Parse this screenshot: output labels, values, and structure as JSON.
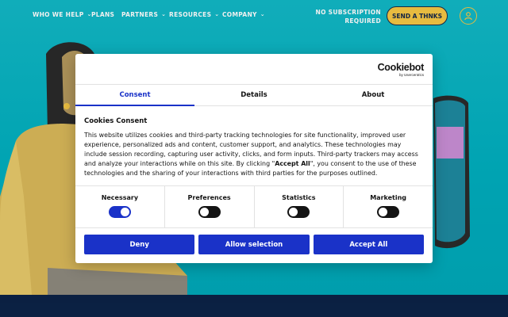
{
  "nav": {
    "items": [
      {
        "label": "WHO WE HELP",
        "has_dropdown": true
      },
      {
        "label": "PLANS",
        "has_dropdown": false
      },
      {
        "label": "PARTNERS",
        "has_dropdown": true
      },
      {
        "label": "RESOURCES",
        "has_dropdown": true
      },
      {
        "label": "COMPANY",
        "has_dropdown": true
      }
    ],
    "no_subscription_line1": "NO SUBSCRIPTION",
    "no_subscription_line2": "REQUIRED",
    "cta_label": "SEND A THNKS",
    "user_icon": "user-icon"
  },
  "cookie_dialog": {
    "brand": "Cookiebot",
    "brand_sub": "by Usercentrics",
    "tabs": [
      "Consent",
      "Details",
      "About"
    ],
    "active_tab": "Consent",
    "heading": "Cookies Consent",
    "body_part1": "This website utilizes cookies and third-party tracking technologies for site functionality, improved user experience, personalized ads and content, customer support, and analytics. These technologies may include session recording, capturing user activity, clicks, and form inputs. Third-party trackers may access and analyze your interactions while on this site. By clicking \"",
    "body_bold": "Accept All",
    "body_part2": "\", you consent to the use of these technologies and the sharing of your interactions with third parties for the purposes outlined.",
    "toggles": [
      {
        "label": "Necessary",
        "on": true
      },
      {
        "label": "Preferences",
        "on": false
      },
      {
        "label": "Statistics",
        "on": false
      },
      {
        "label": "Marketing",
        "on": false
      }
    ],
    "buttons": {
      "deny": "Deny",
      "allow_selection": "Allow selection",
      "accept_all": "Accept All"
    }
  },
  "colors": {
    "hero_bg": "#00b2c2",
    "accent_yellow": "#f6c744",
    "primary_blue": "#1a32c8",
    "footer_navy": "#0c2347"
  }
}
